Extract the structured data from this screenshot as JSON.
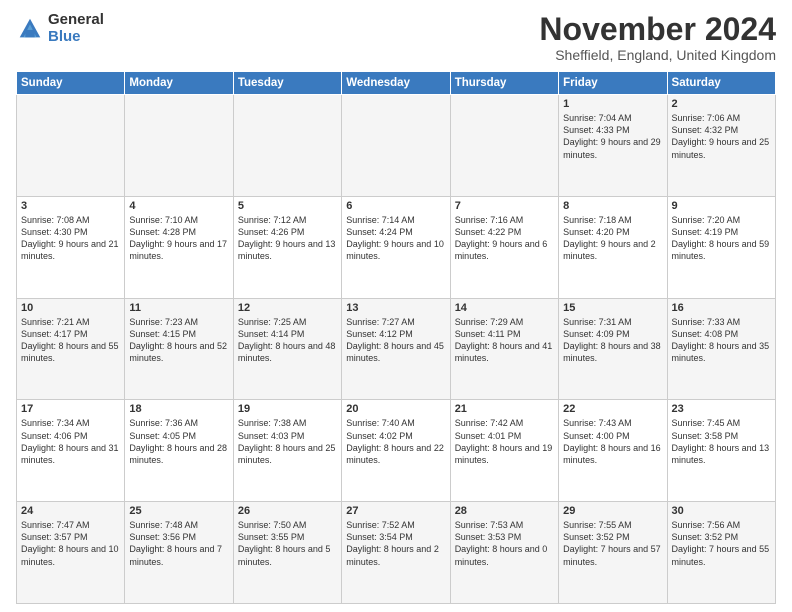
{
  "logo": {
    "general": "General",
    "blue": "Blue"
  },
  "header": {
    "month": "November 2024",
    "location": "Sheffield, England, United Kingdom"
  },
  "weekdays": [
    "Sunday",
    "Monday",
    "Tuesday",
    "Wednesday",
    "Thursday",
    "Friday",
    "Saturday"
  ],
  "weeks": [
    [
      {
        "day": "",
        "info": ""
      },
      {
        "day": "",
        "info": ""
      },
      {
        "day": "",
        "info": ""
      },
      {
        "day": "",
        "info": ""
      },
      {
        "day": "",
        "info": ""
      },
      {
        "day": "1",
        "info": "Sunrise: 7:04 AM\nSunset: 4:33 PM\nDaylight: 9 hours and 29 minutes."
      },
      {
        "day": "2",
        "info": "Sunrise: 7:06 AM\nSunset: 4:32 PM\nDaylight: 9 hours and 25 minutes."
      }
    ],
    [
      {
        "day": "3",
        "info": "Sunrise: 7:08 AM\nSunset: 4:30 PM\nDaylight: 9 hours and 21 minutes."
      },
      {
        "day": "4",
        "info": "Sunrise: 7:10 AM\nSunset: 4:28 PM\nDaylight: 9 hours and 17 minutes."
      },
      {
        "day": "5",
        "info": "Sunrise: 7:12 AM\nSunset: 4:26 PM\nDaylight: 9 hours and 13 minutes."
      },
      {
        "day": "6",
        "info": "Sunrise: 7:14 AM\nSunset: 4:24 PM\nDaylight: 9 hours and 10 minutes."
      },
      {
        "day": "7",
        "info": "Sunrise: 7:16 AM\nSunset: 4:22 PM\nDaylight: 9 hours and 6 minutes."
      },
      {
        "day": "8",
        "info": "Sunrise: 7:18 AM\nSunset: 4:20 PM\nDaylight: 9 hours and 2 minutes."
      },
      {
        "day": "9",
        "info": "Sunrise: 7:20 AM\nSunset: 4:19 PM\nDaylight: 8 hours and 59 minutes."
      }
    ],
    [
      {
        "day": "10",
        "info": "Sunrise: 7:21 AM\nSunset: 4:17 PM\nDaylight: 8 hours and 55 minutes."
      },
      {
        "day": "11",
        "info": "Sunrise: 7:23 AM\nSunset: 4:15 PM\nDaylight: 8 hours and 52 minutes."
      },
      {
        "day": "12",
        "info": "Sunrise: 7:25 AM\nSunset: 4:14 PM\nDaylight: 8 hours and 48 minutes."
      },
      {
        "day": "13",
        "info": "Sunrise: 7:27 AM\nSunset: 4:12 PM\nDaylight: 8 hours and 45 minutes."
      },
      {
        "day": "14",
        "info": "Sunrise: 7:29 AM\nSunset: 4:11 PM\nDaylight: 8 hours and 41 minutes."
      },
      {
        "day": "15",
        "info": "Sunrise: 7:31 AM\nSunset: 4:09 PM\nDaylight: 8 hours and 38 minutes."
      },
      {
        "day": "16",
        "info": "Sunrise: 7:33 AM\nSunset: 4:08 PM\nDaylight: 8 hours and 35 minutes."
      }
    ],
    [
      {
        "day": "17",
        "info": "Sunrise: 7:34 AM\nSunset: 4:06 PM\nDaylight: 8 hours and 31 minutes."
      },
      {
        "day": "18",
        "info": "Sunrise: 7:36 AM\nSunset: 4:05 PM\nDaylight: 8 hours and 28 minutes."
      },
      {
        "day": "19",
        "info": "Sunrise: 7:38 AM\nSunset: 4:03 PM\nDaylight: 8 hours and 25 minutes."
      },
      {
        "day": "20",
        "info": "Sunrise: 7:40 AM\nSunset: 4:02 PM\nDaylight: 8 hours and 22 minutes."
      },
      {
        "day": "21",
        "info": "Sunrise: 7:42 AM\nSunset: 4:01 PM\nDaylight: 8 hours and 19 minutes."
      },
      {
        "day": "22",
        "info": "Sunrise: 7:43 AM\nSunset: 4:00 PM\nDaylight: 8 hours and 16 minutes."
      },
      {
        "day": "23",
        "info": "Sunrise: 7:45 AM\nSunset: 3:58 PM\nDaylight: 8 hours and 13 minutes."
      }
    ],
    [
      {
        "day": "24",
        "info": "Sunrise: 7:47 AM\nSunset: 3:57 PM\nDaylight: 8 hours and 10 minutes."
      },
      {
        "day": "25",
        "info": "Sunrise: 7:48 AM\nSunset: 3:56 PM\nDaylight: 8 hours and 7 minutes."
      },
      {
        "day": "26",
        "info": "Sunrise: 7:50 AM\nSunset: 3:55 PM\nDaylight: 8 hours and 5 minutes."
      },
      {
        "day": "27",
        "info": "Sunrise: 7:52 AM\nSunset: 3:54 PM\nDaylight: 8 hours and 2 minutes."
      },
      {
        "day": "28",
        "info": "Sunrise: 7:53 AM\nSunset: 3:53 PM\nDaylight: 8 hours and 0 minutes."
      },
      {
        "day": "29",
        "info": "Sunrise: 7:55 AM\nSunset: 3:52 PM\nDaylight: 7 hours and 57 minutes."
      },
      {
        "day": "30",
        "info": "Sunrise: 7:56 AM\nSunset: 3:52 PM\nDaylight: 7 hours and 55 minutes."
      }
    ]
  ]
}
